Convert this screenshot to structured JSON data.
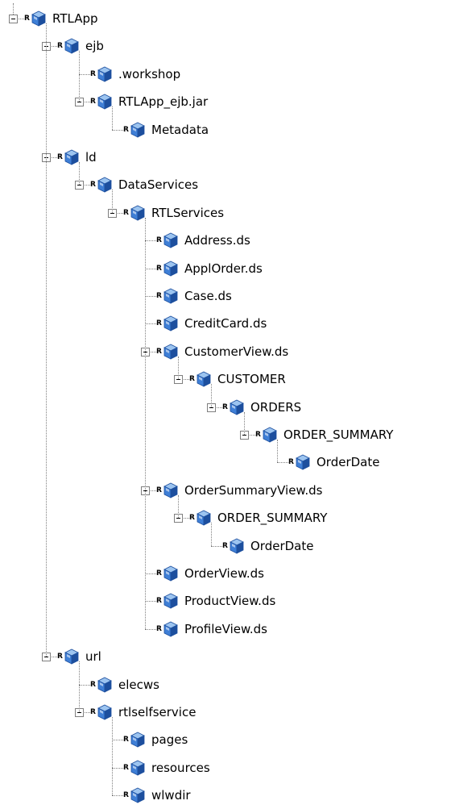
{
  "tree": [
    {
      "label": "RTLApp",
      "expanded": true,
      "children": [
        {
          "label": "ejb",
          "expanded": true,
          "children": [
            {
              "label": ".workshop"
            },
            {
              "label": "RTLApp_ejb.jar",
              "expanded": true,
              "children": [
                {
                  "label": "Metadata"
                }
              ]
            }
          ]
        },
        {
          "label": "ld",
          "expanded": true,
          "children": [
            {
              "label": "DataServices",
              "expanded": true,
              "children": [
                {
                  "label": "RTLServices",
                  "expanded": true,
                  "children": [
                    {
                      "label": "Address.ds"
                    },
                    {
                      "label": "ApplOrder.ds"
                    },
                    {
                      "label": "Case.ds"
                    },
                    {
                      "label": "CreditCard.ds"
                    },
                    {
                      "label": "CustomerView.ds",
                      "expanded": true,
                      "children": [
                        {
                          "label": "CUSTOMER",
                          "expanded": true,
                          "children": [
                            {
                              "label": "ORDERS",
                              "expanded": true,
                              "children": [
                                {
                                  "label": "ORDER_SUMMARY",
                                  "expanded": true,
                                  "children": [
                                    {
                                      "label": "OrderDate"
                                    }
                                  ]
                                }
                              ]
                            }
                          ]
                        }
                      ]
                    },
                    {
                      "label": "OrderSummaryView.ds",
                      "expanded": true,
                      "children": [
                        {
                          "label": "ORDER_SUMMARY",
                          "expanded": true,
                          "children": [
                            {
                              "label": "OrderDate"
                            }
                          ]
                        }
                      ]
                    },
                    {
                      "label": "OrderView.ds"
                    },
                    {
                      "label": "ProductView.ds"
                    },
                    {
                      "label": "ProfileView.ds"
                    }
                  ]
                }
              ]
            }
          ]
        },
        {
          "label": "url",
          "expanded": true,
          "children": [
            {
              "label": "elecws"
            },
            {
              "label": "rtlselfservice",
              "expanded": true,
              "children": [
                {
                  "label": "pages"
                },
                {
                  "label": "resources"
                },
                {
                  "label": "wlwdir"
                }
              ]
            }
          ]
        }
      ]
    }
  ],
  "node_badge": "R",
  "icon": "blue-cube-icon",
  "colors": {
    "cube_light": "#9cc4f0",
    "cube_mid": "#3f7fd6",
    "cube_dark": "#1d4f9e",
    "guide": "#808080"
  }
}
